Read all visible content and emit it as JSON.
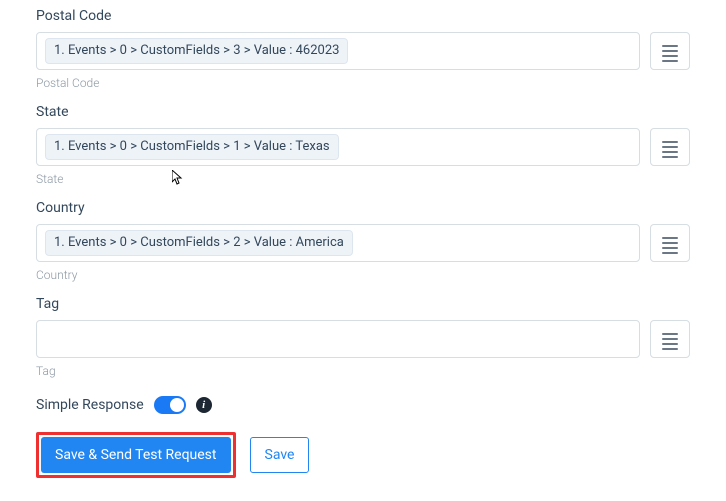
{
  "fields": [
    {
      "label": "Postal Code",
      "chip": "1. Events > 0 > CustomFields > 3 > Value : 462023",
      "help": "Postal Code"
    },
    {
      "label": "State",
      "chip": "1. Events > 0 > CustomFields > 1 > Value : Texas",
      "help": "State"
    },
    {
      "label": "Country",
      "chip": "1. Events > 0 > CustomFields > 2 > Value : America",
      "help": "Country"
    },
    {
      "label": "Tag",
      "chip": "",
      "help": "Tag"
    }
  ],
  "simple_response_label": "Simple Response",
  "info_glyph": "i",
  "buttons": {
    "primary": "Save & Send Test Request",
    "secondary": "Save"
  }
}
